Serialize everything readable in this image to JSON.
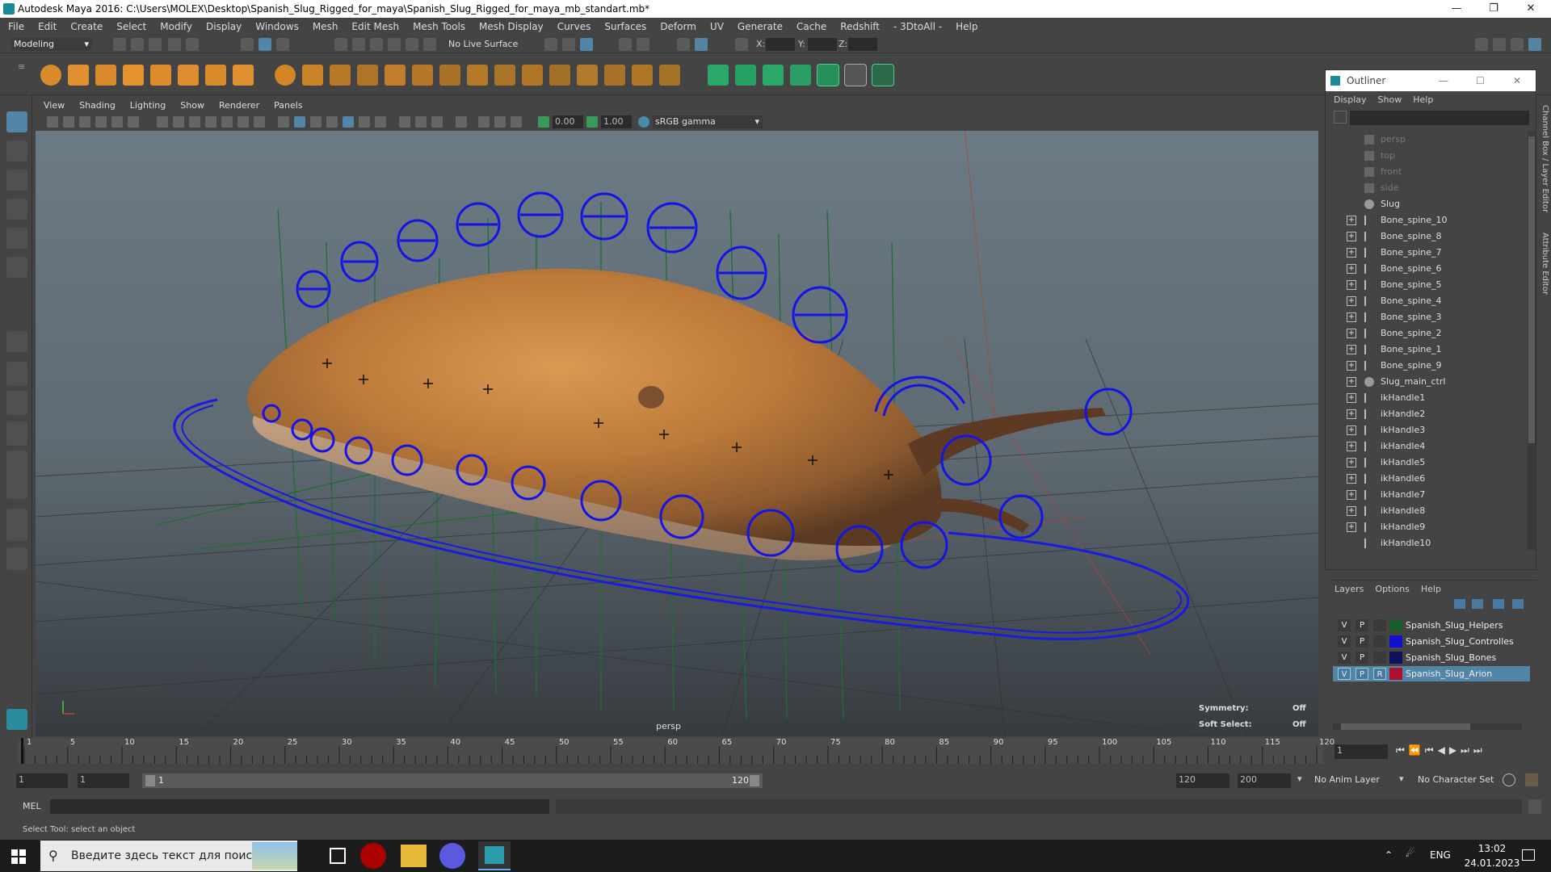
{
  "window": {
    "title": "Autodesk Maya 2016: C:\\Users\\MOLEX\\Desktop\\Spanish_Slug_Rigged_for_maya\\Spanish_Slug_Rigged_for_maya_mb_standart.mb*"
  },
  "menus": [
    "File",
    "Edit",
    "Create",
    "Select",
    "Modify",
    "Display",
    "Windows",
    "Mesh",
    "Edit Mesh",
    "Mesh Tools",
    "Mesh Display",
    "Curves",
    "Surfaces",
    "Deform",
    "UV",
    "Generate",
    "Cache",
    "Redshift",
    "- 3DtoAll -",
    "Help"
  ],
  "status_line": {
    "mode": "Modeling",
    "live_surface": "No Live Surface",
    "x_label": "X:",
    "y_label": "Y:",
    "z_label": "Z:"
  },
  "viewport": {
    "menus": [
      "View",
      "Shading",
      "Lighting",
      "Show",
      "Renderer",
      "Panels"
    ],
    "exposure": "0.00",
    "gamma": "1.00",
    "color_space": "sRGB gamma",
    "camera_label": "persp",
    "hud": {
      "symmetry_label": "Symmetry:",
      "symmetry_value": "Off",
      "soft_select_label": "Soft Select:",
      "soft_select_value": "Off"
    }
  },
  "outliner": {
    "title": "Outliner",
    "menus": [
      "Display",
      "Show",
      "Help"
    ],
    "cameras": [
      "persp",
      "top",
      "front",
      "side"
    ],
    "items": [
      "Slug",
      "Bone_spine_10",
      "Bone_spine_8",
      "Bone_spine_7",
      "Bone_spine_6",
      "Bone_spine_5",
      "Bone_spine_4",
      "Bone_spine_3",
      "Bone_spine_2",
      "Bone_spine_1",
      "Bone_spine_9",
      "Slug_main_ctrl",
      "ikHandle1",
      "ikHandle2",
      "ikHandle3",
      "ikHandle4",
      "ikHandle5",
      "ikHandle6",
      "ikHandle7",
      "ikHandle8",
      "ikHandle9",
      "ikHandle10"
    ],
    "side_tabs": [
      "Channel Box / Layer Editor",
      "Attribute Editor"
    ]
  },
  "layers": {
    "menus": [
      "Layers",
      "Options",
      "Help"
    ],
    "rows": [
      {
        "v": "V",
        "p": "P",
        "r": "",
        "name": "Spanish_Slug_Helpers",
        "color": "#1a5c2a"
      },
      {
        "v": "V",
        "p": "P",
        "r": "",
        "name": "Spanish_Slug_Controlles",
        "color": "#1010d0"
      },
      {
        "v": "V",
        "p": "P",
        "r": "",
        "name": "Spanish_Slug_Bones",
        "color": "#101060"
      },
      {
        "v": "V",
        "p": "P",
        "r": "R",
        "name": "Spanish_Slug_Arion",
        "color": "#b01030"
      }
    ]
  },
  "timeline": {
    "ticks": [
      "1",
      "5",
      "10",
      "15",
      "20",
      "25",
      "30",
      "35",
      "40",
      "45",
      "50",
      "55",
      "60",
      "65",
      "70",
      "75",
      "80",
      "85",
      "90",
      "95",
      "100",
      "105",
      "110",
      "115",
      "120"
    ],
    "current_frame": "1"
  },
  "range": {
    "start": "1",
    "playback_start": "1",
    "range_start_label": "1",
    "range_end_label": "120",
    "end": "120",
    "max": "200",
    "anim_layer": "No Anim Layer",
    "char_set": "No Character Set"
  },
  "mel": {
    "label": "MEL"
  },
  "help_line": "Select Tool: select an object",
  "taskbar": {
    "search_placeholder": "Введите здесь текст для поиска",
    "lang": "ENG",
    "time": "13:02",
    "date": "24.01.2023"
  }
}
